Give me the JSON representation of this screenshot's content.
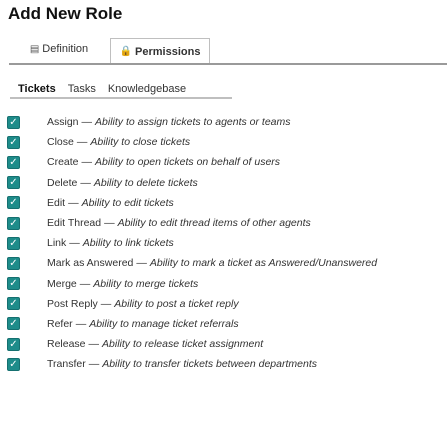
{
  "page": {
    "title": "Add New Role"
  },
  "role_tabs": [
    {
      "label": "Definition",
      "icon": "document-icon"
    },
    {
      "label": "Permissions",
      "icon": "lock-icon",
      "active": true
    }
  ],
  "sub_tabs": [
    "Tickets",
    "Tasks",
    "Knowledgebase"
  ],
  "permissions": [
    {
      "name": "Assign",
      "desc": "Ability to assign tickets to agents or teams",
      "checked": true
    },
    {
      "name": "Close",
      "desc": "Ability to close tickets",
      "checked": true
    },
    {
      "name": "Create",
      "desc": "Ability to open tickets on behalf of users",
      "checked": true
    },
    {
      "name": "Delete",
      "desc": "Ability to delete tickets",
      "checked": true
    },
    {
      "name": "Edit",
      "desc": "Ability to edit tickets",
      "checked": true
    },
    {
      "name": "Edit Thread",
      "desc": "Ability to edit thread items of other agents",
      "checked": true
    },
    {
      "name": "Link",
      "desc": "Ability to link tickets",
      "checked": true
    },
    {
      "name": "Mark as Answered",
      "desc": "Ability to mark a ticket as Answered/Unanswered",
      "checked": true
    },
    {
      "name": "Merge",
      "desc": "Ability to merge tickets",
      "checked": true
    },
    {
      "name": "Post Reply",
      "desc": "Ability to post a ticket reply",
      "checked": true
    },
    {
      "name": "Refer",
      "desc": "Ability to manage ticket referrals",
      "checked": true
    },
    {
      "name": "Release",
      "desc": "Ability to release ticket assignment",
      "checked": true
    },
    {
      "name": "Transfer",
      "desc": "Ability to transfer tickets between departments",
      "checked": true
    }
  ]
}
